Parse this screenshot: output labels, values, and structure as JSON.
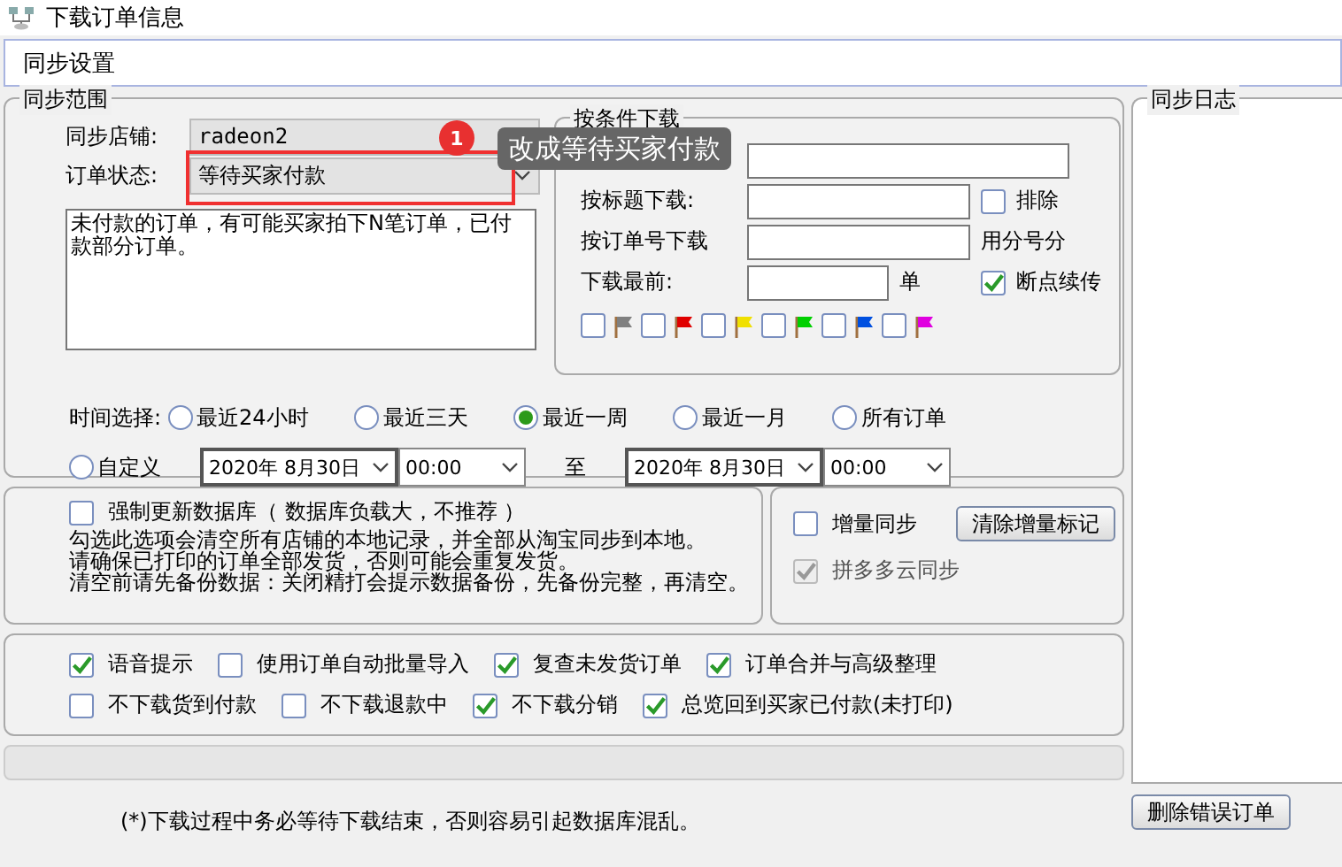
{
  "window": {
    "title": "下载订单信息"
  },
  "section_header": "同步设置",
  "scope": {
    "title": "同步范围",
    "store_label": "同步店铺:",
    "store_value": "radeon2",
    "status_label": "订单状态:",
    "status_value": "等待买家付款",
    "description": "未付款的订单，有可能买家拍下N笔订单，已付款部分订单。",
    "time_label": "时间选择:",
    "time_options": [
      {
        "label": "最近24小时",
        "selected": false
      },
      {
        "label": "最近三天",
        "selected": false
      },
      {
        "label": "最近一周",
        "selected": true
      },
      {
        "label": "最近一月",
        "selected": false
      },
      {
        "label": "所有订单",
        "selected": false
      }
    ],
    "custom": {
      "label": "自定义",
      "selected": false,
      "start_date": "2020年  8月30日",
      "start_time": "00:00",
      "to_label": "至",
      "end_date": "2020年  8月30日",
      "end_time": "00:00"
    }
  },
  "conditions": {
    "title": "按条件下载",
    "title_label": "按标题下载:",
    "exclude": {
      "label": "排除",
      "checked": false
    },
    "order_no_label": "按订单号下载",
    "order_no_hint": "用分号分",
    "recent_label": "下载最前:",
    "recent_unit": "单",
    "resume": {
      "label": "断点续传",
      "checked": true
    },
    "flags": [
      {
        "color": "#808080",
        "checked": false
      },
      {
        "color": "#e00000",
        "checked": false
      },
      {
        "color": "#f0e000",
        "checked": false
      },
      {
        "color": "#00d000",
        "checked": false
      },
      {
        "color": "#0050e0",
        "checked": false
      },
      {
        "color": "#e000e0",
        "checked": false
      }
    ]
  },
  "database": {
    "force_update": {
      "label": "强制更新数据库（ 数据库负载大，不推荐 ）",
      "checked": false
    },
    "notes": [
      "勾选此选项会清空所有店铺的本地记录，并全部从淘宝同步到本地。",
      "请确保已打印的订单全部发货，否则可能会重复发货。",
      "清空前请先备份数据：关闭精打会提示数据备份，先备份完整，再清空。"
    ]
  },
  "incremental": {
    "sync": {
      "label": "增量同步",
      "checked": false
    },
    "clear_button": "清除增量标记",
    "cloud_sync": {
      "label": "拼多多云同步",
      "checked": true,
      "disabled": true
    }
  },
  "options": [
    [
      {
        "label": "语音提示",
        "checked": true
      },
      {
        "label": "使用订单自动批量导入",
        "checked": false
      },
      {
        "label": "复查未发货订单",
        "checked": true
      },
      {
        "label": "订单合并与高级整理",
        "checked": true
      }
    ],
    [
      {
        "label": "不下载货到付款",
        "checked": false
      },
      {
        "label": "不下载退款中",
        "checked": false
      },
      {
        "label": "不下载分销",
        "checked": true
      },
      {
        "label": "总览回到买家已付款(未打印)",
        "checked": true
      }
    ]
  ],
  "note": "(*)下载过程中务必等待下载结束，否则容易引起数据库混乱。",
  "log": {
    "title": "同步日志",
    "delete_button": "删除错误订单"
  },
  "annotation": {
    "badge": "1",
    "text": "改成等待买家付款"
  }
}
